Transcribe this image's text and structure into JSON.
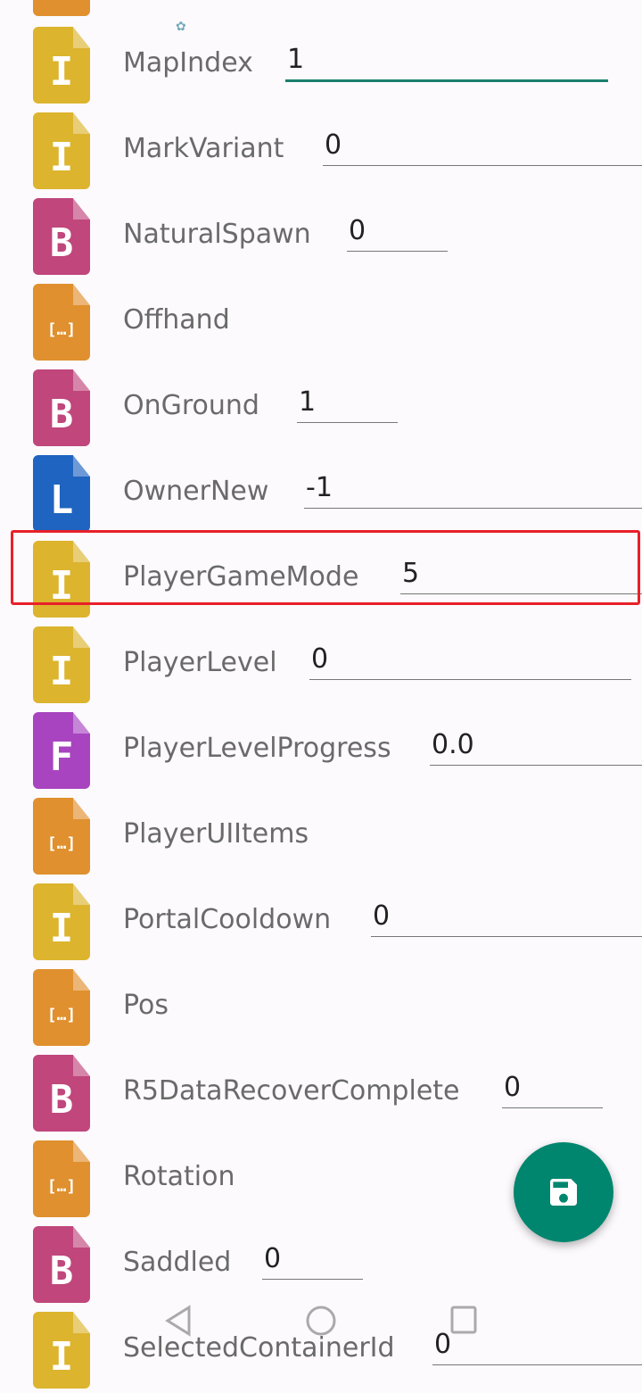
{
  "colors": {
    "int": "#dcb42e",
    "byte": "#c0467c",
    "list": "#e0902e",
    "long": "#1f64c0",
    "float": "#a844c0",
    "accent": "#00866e",
    "highlight": "#e8202a"
  },
  "type_glyphs": {
    "int": "I",
    "byte": "B",
    "list": "[…]",
    "long": "L",
    "float": "F"
  },
  "rows": [
    {
      "name": "MapIndex",
      "type": "int",
      "value": "1",
      "active": true
    },
    {
      "name": "MarkVariant",
      "type": "int",
      "value": "0"
    },
    {
      "name": "NaturalSpawn",
      "type": "byte",
      "value": "0"
    },
    {
      "name": "Offhand",
      "type": "list"
    },
    {
      "name": "OnGround",
      "type": "byte",
      "value": "1"
    },
    {
      "name": "OwnerNew",
      "type": "long",
      "value": "-1"
    },
    {
      "name": "PlayerGameMode",
      "type": "int",
      "value": "5",
      "highlighted": true
    },
    {
      "name": "PlayerLevel",
      "type": "int",
      "value": "0"
    },
    {
      "name": "PlayerLevelProgress",
      "type": "float",
      "value": "0.0"
    },
    {
      "name": "PlayerUIItems",
      "type": "list"
    },
    {
      "name": "PortalCooldown",
      "type": "int",
      "value": "0"
    },
    {
      "name": "Pos",
      "type": "list"
    },
    {
      "name": "R5DataRecoverComplete",
      "type": "byte",
      "value": "0"
    },
    {
      "name": "Rotation",
      "type": "list"
    },
    {
      "name": "Saddled",
      "type": "byte",
      "value": "0"
    },
    {
      "name": "SelectedContainerId",
      "type": "int",
      "value": "0"
    }
  ],
  "fab": {
    "icon": "save-icon"
  },
  "navbar": {
    "back": "back-icon",
    "home": "home-icon",
    "recents": "recents-icon"
  }
}
